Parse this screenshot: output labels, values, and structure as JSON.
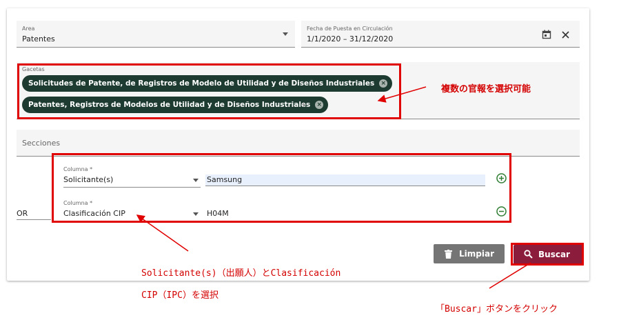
{
  "filters": {
    "area": {
      "label": "Area",
      "value": "Patentes"
    },
    "fecha": {
      "label": "Fecha de Puesta en Circulación",
      "value": "1/1/2020 – 31/12/2020"
    },
    "gacetas": {
      "label": "Gacetas",
      "chips": [
        "Solicitudes de Patente, de Registros de Modelo de Utilidad y de Diseños Industriales",
        "Patentes, Registros de Modelos de Utilidad y de Diseños Industriales"
      ],
      "add_symbol": "+"
    },
    "secciones": {
      "label": "Secciones"
    }
  },
  "criteria": {
    "operator": "OR",
    "rows": [
      {
        "column_label": "Columna *",
        "column_value": "Solicitante(s)",
        "query": "Samsung"
      },
      {
        "column_label": "Columna *",
        "column_value": "Clasificación CIP",
        "query": "H04M"
      }
    ]
  },
  "buttons": {
    "clear": "Limpiar",
    "search": "Buscar"
  },
  "annotations": {
    "gacetas_note": "複数の官報を選択可能",
    "criteria_note_line1": "Solicitante(s)（出願人）とClasificación",
    "criteria_note_line2": "CIP（IPC）を選択",
    "search_note": "「Buscar」ボタンをクリック"
  },
  "colors": {
    "annotation_red": "#e00000",
    "chip_bg": "#1d3b30",
    "clear_btn": "#757575",
    "search_btn": "#8b1c3c",
    "add_icon": "#2e7d32"
  },
  "icons": [
    "dropdown-arrow",
    "calendar-icon",
    "close-icon",
    "chip-remove-icon",
    "add-circle-icon",
    "remove-circle-icon",
    "trash-icon",
    "search-icon"
  ]
}
